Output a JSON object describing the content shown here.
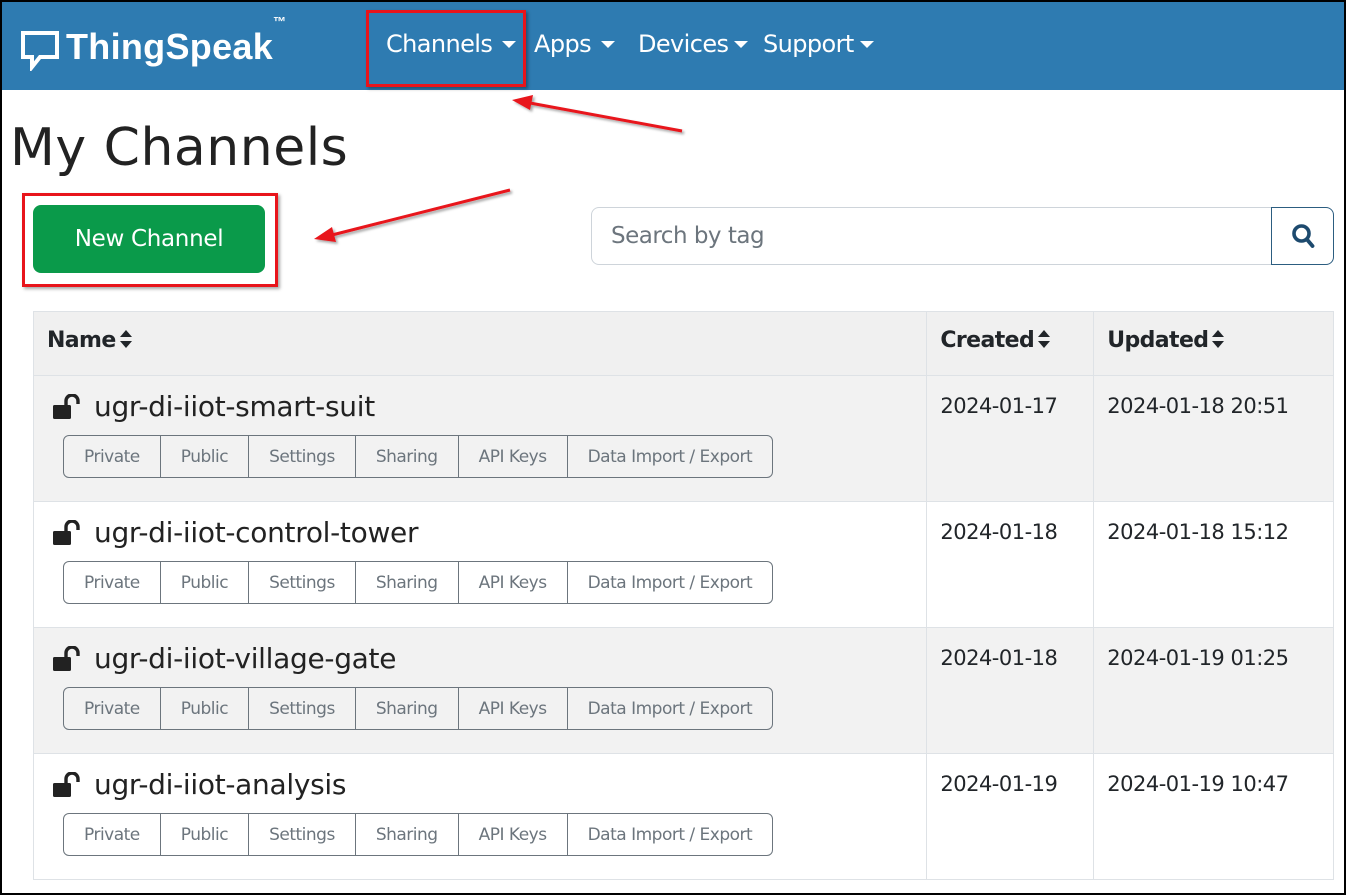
{
  "navbar": {
    "brand": "ThingSpeak",
    "brand_tm": "™",
    "brand_color": "#2e7bb1",
    "items": [
      {
        "label": "Channels",
        "icon": "caret-down-icon"
      },
      {
        "label": "Apps",
        "icon": "caret-down-icon"
      },
      {
        "label": "Devices",
        "icon": "caret-down-icon"
      },
      {
        "label": "Support",
        "icon": "caret-down-icon"
      }
    ]
  },
  "page": {
    "title": "My Channels",
    "new_channel_label": "New Channel",
    "new_channel_color": "#0a9a4a"
  },
  "search": {
    "placeholder": "Search by tag",
    "value": "",
    "button_icon": "search-icon"
  },
  "table": {
    "columns": [
      {
        "label": "Name",
        "sort_icon": "sort-icon"
      },
      {
        "label": "Created",
        "sort_icon": "sort-icon"
      },
      {
        "label": "Updated",
        "sort_icon": "sort-icon"
      }
    ],
    "action_buttons": [
      "Private",
      "Public",
      "Settings",
      "Sharing",
      "API Keys",
      "Data Import / Export"
    ],
    "rows": [
      {
        "name": "ugr-di-iiot-smart-suit",
        "icon": "unlock-icon",
        "created": "2024-01-17",
        "updated": "2024-01-18 20:51"
      },
      {
        "name": "ugr-di-iiot-control-tower",
        "icon": "unlock-icon",
        "created": "2024-01-18",
        "updated": "2024-01-18 15:12"
      },
      {
        "name": "ugr-di-iiot-village-gate",
        "icon": "unlock-icon",
        "created": "2024-01-18",
        "updated": "2024-01-19 01:25"
      },
      {
        "name": "ugr-di-iiot-analysis",
        "icon": "unlock-icon",
        "created": "2024-01-19",
        "updated": "2024-01-19 10:47"
      }
    ]
  },
  "annotations": {
    "highlight_color": "#e8141b",
    "highlighted": [
      "Channels menu",
      "New Channel button"
    ]
  }
}
